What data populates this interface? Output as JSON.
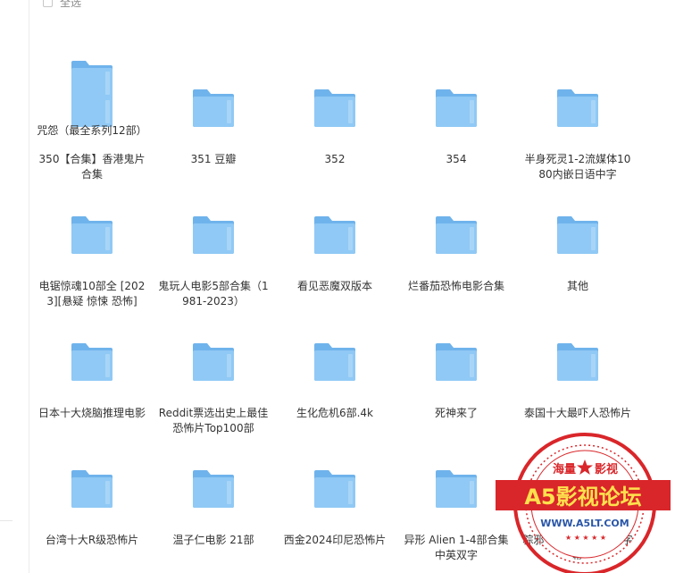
{
  "toolbar": {
    "select_all_label": "全选"
  },
  "files": [
    {
      "name": "350【合集】香港鬼片合集",
      "type": "folder"
    },
    {
      "name": "351 豆瓣",
      "type": "folder"
    },
    {
      "name": "352",
      "type": "folder"
    },
    {
      "name": "354",
      "type": "folder"
    },
    {
      "name": "半身死灵1-2流媒体1080内嵌日语中字",
      "type": "folder"
    },
    {
      "name": "电锯惊魂10部全 [2023][悬疑 惊悚 恐怖]",
      "type": "folder"
    },
    {
      "name": "鬼玩人电影5部合集（1981-2023）",
      "type": "folder"
    },
    {
      "name": "看见恶魔双版本",
      "type": "folder"
    },
    {
      "name": "烂番茄恐怖电影合集",
      "type": "folder"
    },
    {
      "name": "其他",
      "type": "folder"
    },
    {
      "name": "日本十大烧脑推理电影",
      "type": "folder"
    },
    {
      "name": "Reddit票选出史上最佳恐怖片Top100部",
      "type": "folder"
    },
    {
      "name": "生化危机6部.4k",
      "type": "folder"
    },
    {
      "name": "死神来了",
      "type": "folder"
    },
    {
      "name": "泰国十大最吓人恐怖片",
      "type": "folder"
    },
    {
      "name": "台湾十大R级恐怖片",
      "type": "folder"
    },
    {
      "name": "温子仁电影 21部",
      "type": "folder"
    },
    {
      "name": "西金2024印尼恐怖片",
      "type": "folder"
    },
    {
      "name": "异形 Alien 1-4部合集 中英双字",
      "type": "folder"
    },
    {
      "name": "粽邪 1-3部合集 中文字幕",
      "type": "folder"
    },
    {
      "name": "咒怨（最全系列12部）",
      "type": "folder"
    }
  ],
  "watermark": {
    "top_left": "海量",
    "top_right": "影视",
    "title": "A5影视论坛",
    "url": "WWW.A5LT.COM"
  },
  "colors": {
    "folder_front": "#90c9f5",
    "folder_back": "#6fb3ec",
    "folder_tab": "#7dbcf0",
    "stamp_red": "#d9262a",
    "stamp_yellow": "#ffe14d"
  }
}
